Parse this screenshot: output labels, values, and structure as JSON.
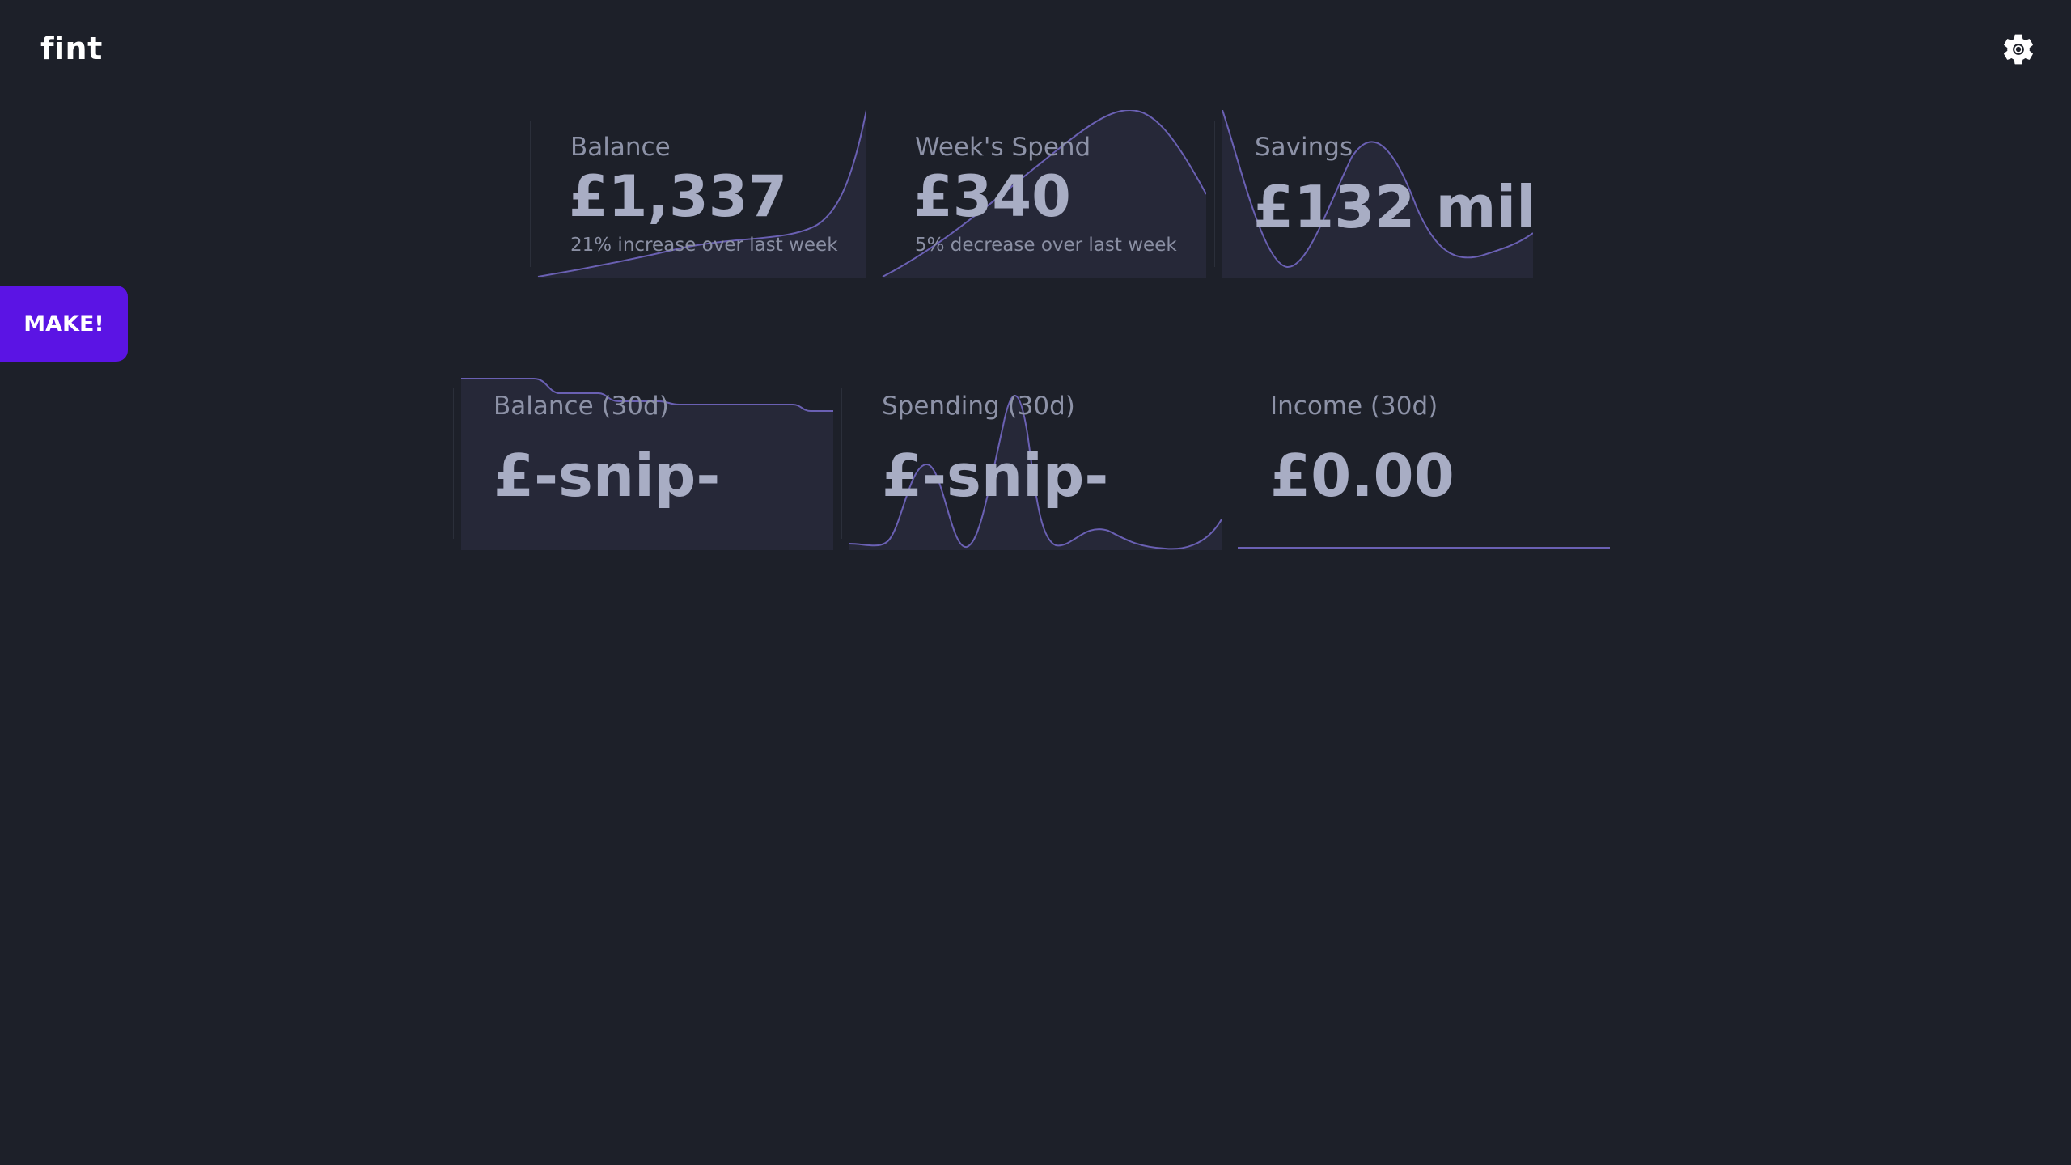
{
  "header": {
    "brand": "fint",
    "settings_icon": "gear-icon"
  },
  "actions": {
    "make_label": "MAKE!"
  },
  "colors": {
    "accent": "#5b14e4",
    "sparkline": "#6a60b3",
    "background": "#1d2029",
    "card_fill": "#262838"
  },
  "summary_cards": [
    {
      "label": "Balance",
      "value": "£1,337",
      "note": "21% increase over last week"
    },
    {
      "label": "Week's Spend",
      "value": "£340",
      "note": "5% decrease over last week"
    },
    {
      "label": "Savings",
      "value": "£132 mil"
    }
  ],
  "period_cards": [
    {
      "label": "Balance (30d)",
      "value": "£-snip-"
    },
    {
      "label": "Spending (30d)",
      "value": "£-snip-"
    },
    {
      "label": "Income (30d)",
      "value": "£0.00"
    }
  ]
}
